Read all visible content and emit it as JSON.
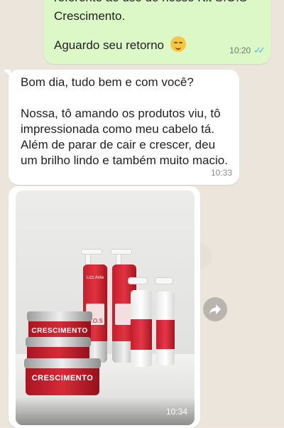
{
  "chat": {
    "outgoing": {
      "line1": "referente ao uso do nosso Kit S.O.S",
      "line2": "Crescimento.",
      "line3": "Aguardo seu retorno",
      "emoji": "smiling-face-icon",
      "time": "10:20",
      "status": "read"
    },
    "incoming_text": {
      "paragraph1": "Bom dia, tudo bem e com você?",
      "paragraph2": "Nossa, tô amando os produtos viu, tô impressionada como meu cabelo tá. Além de parar de cair e crescer, deu um brilho lindo e também muito macio.",
      "time": "10:33"
    },
    "incoming_image": {
      "time": "10:34",
      "product_label": "CRESCIMENTO",
      "brand": "Lizz Ante",
      "product_name": "S.O.S"
    },
    "forward_icon": "forward-icon"
  },
  "colors": {
    "outgoing_bubble": "#dcf8c6",
    "incoming_bubble": "#ffffff",
    "read_ticks": "#4fb6ec",
    "product_red": "#c71d2c"
  }
}
